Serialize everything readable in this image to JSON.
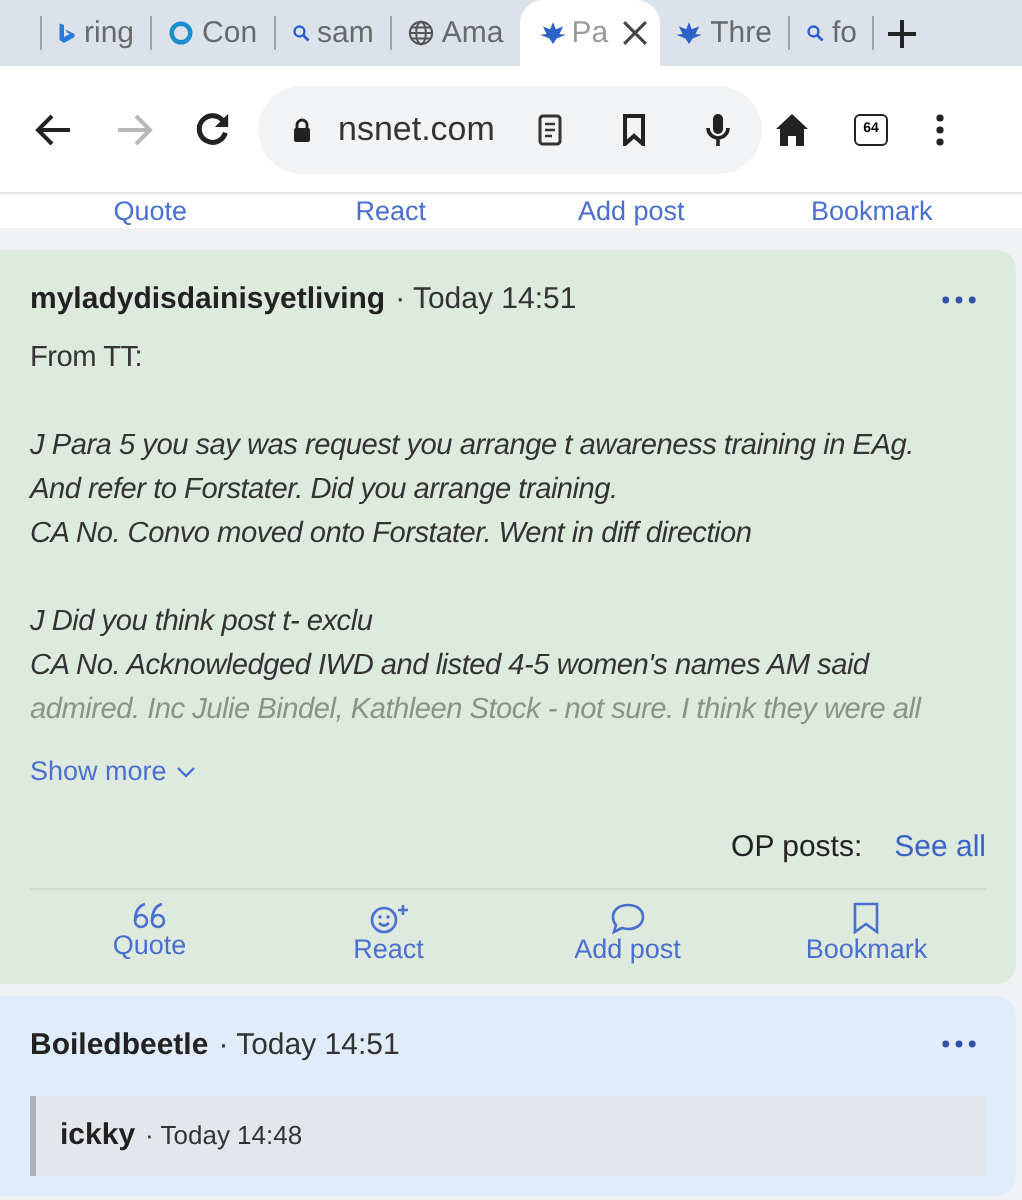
{
  "tabs": [
    {
      "label": "ring",
      "kind": "bing",
      "selected": false
    },
    {
      "label": "Con",
      "kind": "circle",
      "selected": false
    },
    {
      "label": "sam",
      "kind": "search",
      "selected": false
    },
    {
      "label": "Ama",
      "kind": "globe",
      "selected": false
    },
    {
      "label": "Pa",
      "kind": "leaf",
      "selected": true
    },
    {
      "label": "Thre",
      "kind": "leaf",
      "selected": false
    },
    {
      "label": "fo",
      "kind": "search",
      "selected": false
    }
  ],
  "toolbar": {
    "url": "nsnet.com",
    "forward_disabled": true,
    "tab_count": "64"
  },
  "previous_actions": [
    "Quote",
    "React",
    "Add post",
    "Bookmark"
  ],
  "posts": [
    {
      "author": "myladydisdainisyetliving",
      "time": "· Today 14:51",
      "color": "#dfeadf",
      "body": [
        {
          "lines": [
            {
              "text": "From TT:",
              "italic": false,
              "faded": false
            }
          ]
        },
        {
          "lines": [
            {
              "text": "J Para 5 you say was request you arrange t awareness training in EAg.",
              "italic": true,
              "faded": false
            },
            {
              "text": "And refer to Forstater. Did you arrange training.",
              "italic": true,
              "faded": false
            },
            {
              "text": "CA No. Convo moved onto Forstater. Went in diff direction",
              "italic": true,
              "faded": false
            }
          ]
        },
        {
          "lines": [
            {
              "text": "J Did you think post t- exclu",
              "italic": true,
              "faded": false
            },
            {
              "text": "CA No. Acknowledged IWD and listed 4-5 women's names AM said",
              "italic": true,
              "faded": false
            },
            {
              "text": "admired. Inc Julie Bindel, Kathleen Stock - not sure. I think they were all",
              "italic": true,
              "faded": true
            }
          ]
        }
      ],
      "show_more": "Show more",
      "op_label": "OP posts:",
      "op_link": "See all",
      "actions": [
        {
          "label": "Quote",
          "kind": "quote"
        },
        {
          "label": "React",
          "kind": "react"
        },
        {
          "label": "Add post",
          "kind": "comment"
        },
        {
          "label": "Bookmark",
          "kind": "bookmark"
        }
      ]
    },
    {
      "author": "Boiledbeetle",
      "time": "· Today 14:51",
      "color": "#e1ecfb",
      "quote": {
        "author": "ickky",
        "time": "· Today 14:48"
      }
    }
  ]
}
